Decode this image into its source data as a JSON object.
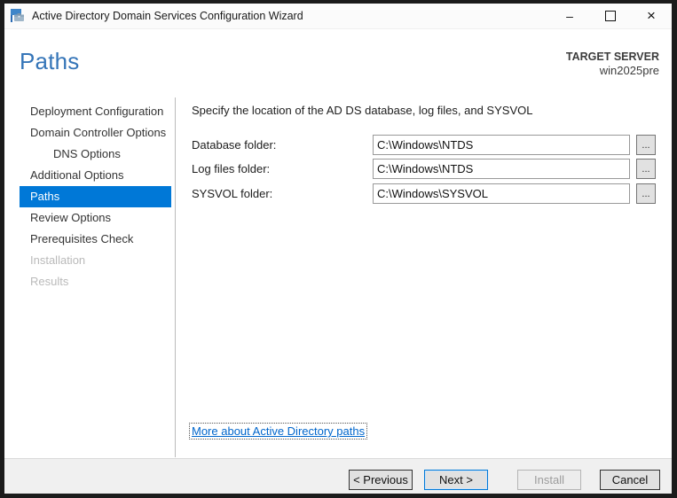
{
  "window": {
    "title": "Active Directory Domain Services Configuration Wizard",
    "icons": {
      "minimize": "–",
      "maximize": "css-box",
      "close": "×",
      "app": "wizard-flag-toolbox"
    }
  },
  "header": {
    "page_title": "Paths",
    "target_server_label": "TARGET SERVER",
    "target_server_name": "win2025pre"
  },
  "sidebar": {
    "items": [
      {
        "label": "Deployment Configuration",
        "state": "normal"
      },
      {
        "label": "Domain Controller Options",
        "state": "normal"
      },
      {
        "label": "DNS Options",
        "state": "normal-indented"
      },
      {
        "label": "Additional Options",
        "state": "normal"
      },
      {
        "label": "Paths",
        "state": "selected"
      },
      {
        "label": "Review Options",
        "state": "normal"
      },
      {
        "label": "Prerequisites Check",
        "state": "normal"
      },
      {
        "label": "Installation",
        "state": "disabled"
      },
      {
        "label": "Results",
        "state": "disabled"
      }
    ]
  },
  "content": {
    "instruction": "Specify the location of the AD DS database, log files, and SYSVOL",
    "browse_label": "...",
    "fields": [
      {
        "label": "Database folder:",
        "value": "C:\\Windows\\NTDS"
      },
      {
        "label": "Log files folder:",
        "value": "C:\\Windows\\NTDS"
      },
      {
        "label": "SYSVOL folder:",
        "value": "C:\\Windows\\SYSVOL"
      }
    ],
    "link": "More about Active Directory paths"
  },
  "footer": {
    "buttons": [
      {
        "label": "< Previous",
        "state": "enabled"
      },
      {
        "label": "Next >",
        "state": "default"
      },
      {
        "label": "Install",
        "state": "disabled"
      },
      {
        "label": "Cancel",
        "state": "enabled"
      }
    ]
  },
  "colors": {
    "accent": "#0078d7",
    "heading_blue": "#3575b8",
    "link_blue": "#0066cc",
    "window_border": "#1b1b1b",
    "footer_bg": "#f0f0f0"
  }
}
